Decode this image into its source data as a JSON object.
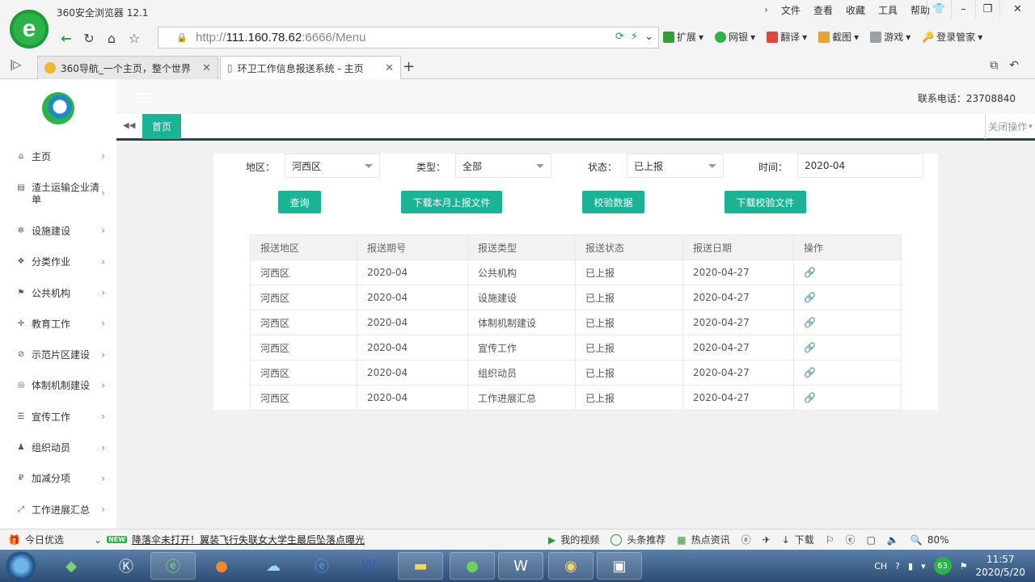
{
  "browser": {
    "app_title": "360安全浏览器 12.1",
    "menu": [
      "文件",
      "查看",
      "收藏",
      "工具",
      "帮助"
    ],
    "url_prefix": "http://",
    "url_host": "111.160.78.62",
    "url_rest": ":6666/Menu",
    "extensions": [
      "扩展",
      "网银",
      "翻译",
      "截图",
      "游戏",
      "登录管家"
    ],
    "tabs": [
      {
        "title": "360导航_一个主页，整个世界",
        "active": false
      },
      {
        "title": "环卫工作信息报送系统 - 主页",
        "active": true
      }
    ]
  },
  "header": {
    "phone": "联系电话：23708840",
    "home_tab": "首页",
    "close_ops": "关闭操作"
  },
  "sidebar": {
    "items": [
      {
        "label": "主页",
        "icon": "home-icon"
      },
      {
        "label": "渣土运输企业清单",
        "icon": "file-icon"
      },
      {
        "label": "设施建设",
        "icon": "gear-icon"
      },
      {
        "label": "分类作业",
        "icon": "cubes-icon"
      },
      {
        "label": "公共机构",
        "icon": "flag-icon"
      },
      {
        "label": "教育工作",
        "icon": "crosshair-icon"
      },
      {
        "label": "示范片区建设",
        "icon": "ban-icon"
      },
      {
        "label": "体制机制建设",
        "icon": "globe-icon"
      },
      {
        "label": "宣传工作",
        "icon": "list-icon"
      },
      {
        "label": "组织动员",
        "icon": "users-icon"
      },
      {
        "label": "加减分项",
        "icon": "ruble-icon"
      },
      {
        "label": "工作进展汇总",
        "icon": "expand-icon"
      }
    ]
  },
  "filters": {
    "region_label": "地区：",
    "region_value": "河西区",
    "type_label": "类型：",
    "type_value": "全部",
    "status_label": "状态：",
    "status_value": "已上报",
    "time_label": "时间：",
    "time_value": "2020-04"
  },
  "buttons": {
    "query": "查询",
    "download_month": "下载本月上报文件",
    "validate": "校验数据",
    "download_validate": "下载校验文件"
  },
  "table": {
    "columns": [
      "报送地区",
      "报送期号",
      "报送类型",
      "报送状态",
      "报送日期",
      "操作"
    ],
    "rows": [
      [
        "河西区",
        "2020-04",
        "公共机构",
        "已上报",
        "2020-04-27"
      ],
      [
        "河西区",
        "2020-04",
        "设施建设",
        "已上报",
        "2020-04-27"
      ],
      [
        "河西区",
        "2020-04",
        "体制机制建设",
        "已上报",
        "2020-04-27"
      ],
      [
        "河西区",
        "2020-04",
        "宣传工作",
        "已上报",
        "2020-04-27"
      ],
      [
        "河西区",
        "2020-04",
        "组织动员",
        "已上报",
        "2020-04-27"
      ],
      [
        "河西区",
        "2020-04",
        "工作进展汇总",
        "已上报",
        "2020-04-27"
      ]
    ]
  },
  "statusbar": {
    "today": "今日优选",
    "news_badge": "NEW",
    "news": "降落伞未打开！翼装飞行失联女大学生最后坠落点曝光",
    "my_video": "我的视频",
    "headline": "头条推荐",
    "hot": "热点资讯",
    "download": "下载",
    "zoom": "80%"
  },
  "taskbar": {
    "ime": "CH",
    "badge": "63",
    "time": "11:57",
    "date": "2020/5/20"
  },
  "colors": {
    "accent": "#1ab394",
    "sidebar_bg": "#ffffff",
    "page_bg": "#f1f1f1"
  }
}
